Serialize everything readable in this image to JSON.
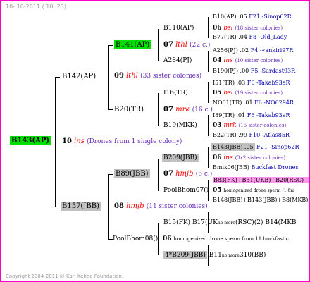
{
  "header": "10- 10-2011 ( 10: 23)",
  "footer": "Copyright 2004-2011 @ Karl Kehde Foundation.",
  "root": {
    "name": "B143(AP)",
    "gen": "10",
    "ins": "ins",
    "note": "(Drones from 1 single colony)"
  },
  "p1": {
    "name": "B142(AP)",
    "gen": "09",
    "ins": "lthl",
    "note": "(33 sister colonies)"
  },
  "p2": {
    "name": "B157(JBB)",
    "gen": "08",
    "ins": "hmjb",
    "note": "(11 sister colonies)"
  },
  "g1": {
    "name": "B141(AP)",
    "gen": "07",
    "ins": "lthl",
    "note": "(22 c.)"
  },
  "g2": {
    "name": "B20(TR)",
    "gen": "07",
    "ins": "mrk",
    "note": "(16 c.)"
  },
  "g3": {
    "name": "B89(JBB)",
    "gen": "07",
    "ins": "hmjb",
    "note": "(6 c.)"
  },
  "g4": {
    "name": "PoolBhom08()",
    "gen": "06",
    "note": "homogenized drone sperm from 11 buckfast c"
  },
  "h1": {
    "name": "B110(AP)",
    "gen": "06",
    "ins": "bsl",
    "note": "(18 sister colonies)"
  },
  "h2": {
    "name": "A284(PJ)",
    "gen": "04",
    "ins": "ins",
    "note": "(10 sister colonies)"
  },
  "h3": {
    "name": "I16(TR)",
    "gen": "05",
    "ins": "bsl",
    "note": "(19 sister colonies)"
  },
  "h4": {
    "name": "B19(MKK)",
    "gen": "03",
    "ins": "mrk",
    "note": "(15 sister colonies)"
  },
  "h5": {
    "name": "B209(JBB)",
    "gen": "06",
    "ins": "ins",
    "note": "(3x2 sister colonies)"
  },
  "h6": {
    "name": "PoolBhom07()",
    "gen": "05",
    "note": "homogenized drone sperm (1.6m"
  },
  "h7": {
    "name": "B15(FK)",
    "tail": "B17(UK",
    "tail2": "no more",
    "tail3": "(RSC)(2) B14(MKB"
  },
  "h8": {
    "name": "4*B209(JBB)",
    "tail": "B11",
    "tail2": "no more",
    "tail3": "310(BB)"
  },
  "leaves": [
    {
      "text": "B10(AP) .05",
      "tail": "F21 -Sinop62R"
    },
    {
      "text": "B77(TR) .04",
      "tail": "F8 -Old_Lady"
    },
    {
      "text": "A256(PJ) .02",
      "tail": "F4 -«ankiri97R"
    },
    {
      "text": "B190(PJ) .00",
      "tail": "F5 -Sardast93R"
    },
    {
      "text": "I51(TR) .03",
      "tail": "F6 -Takab93aR"
    },
    {
      "text": "NO61(TR) .01",
      "tail": "F6 -NO6294R"
    },
    {
      "text": "I89(TR) .01",
      "tail": "F6 -Takab93aR"
    },
    {
      "text": "B22(TR) .99",
      "tail": "F10 -Atlas85R"
    },
    {
      "text": "B143(JBB) .05",
      "tail": "F21 -Sinop62R"
    },
    {
      "text": "Bmix06(JBB)",
      "tail": "Buckfast Drones"
    },
    {
      "text": "B83(FK)+B31(UKB)+B20(RSC)+",
      "tail": ""
    },
    {
      "text": "B148(JBB)+B143(JBB)+B8(MKB)",
      "tail": ""
    }
  ]
}
